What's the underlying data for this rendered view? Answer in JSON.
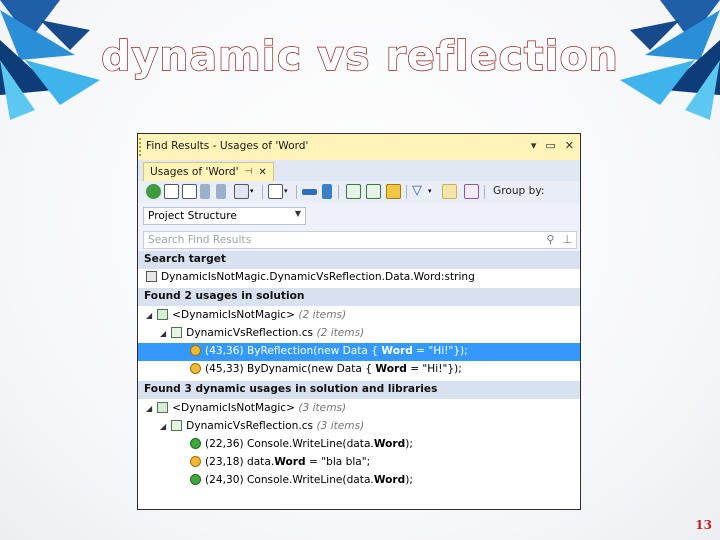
{
  "slide": {
    "title": "dynamic vs reflection",
    "page_number": "13"
  },
  "window": {
    "title": "Find Results - Usages of 'Word'",
    "tab_label": "Usages of 'Word'",
    "group_by_label": "Group by:",
    "structure_select": "Project Structure",
    "search_placeholder": "Search Find Results"
  },
  "results": {
    "search_target_header": "Search target",
    "search_target_value": "DynamicIsNotMagic.DynamicVsReflection.Data.Word:string",
    "section1_header": "Found 2 usages in solution",
    "s1_project": "<DynamicIsNotMagic>",
    "s1_project_count": "(2 items)",
    "s1_file": "DynamicVsReflection.cs",
    "s1_file_count": "(2 items)",
    "s1_item1_loc": "(43,36)",
    "s1_item1_pre": "ByReflection(new Data {",
    "s1_item1_bold": "Word",
    "s1_item1_post": "= \"Hi!\"});",
    "s1_item2_loc": "(45,33)",
    "s1_item2_pre": "ByDynamic(new Data {",
    "s1_item2_bold": "Word",
    "s1_item2_post": "= \"Hi!\"});",
    "section2_header": "Found 3 dynamic usages in solution and libraries",
    "s2_project": "<DynamicIsNotMagic>",
    "s2_project_count": "(3 items)",
    "s2_file": "DynamicVsReflection.cs",
    "s2_file_count": "(3 items)",
    "s2_item1_loc": "(22,36)",
    "s2_item1_pre": "Console.WriteLine(data.",
    "s2_item1_bold": "Word",
    "s2_item1_post": ");",
    "s2_item2_loc": "(23,18)",
    "s2_item2_pre": "data.",
    "s2_item2_bold": "Word",
    "s2_item2_post": "= \"bla bla\";",
    "s2_item3_loc": "(24,30)",
    "s2_item3_pre": "Console.WriteLine(data.",
    "s2_item3_bold": "Word",
    "s2_item3_post": ");"
  },
  "colors": {
    "title_bar": "#fff3b8",
    "selection": "#3399ff",
    "section_header": "#d8e1ef",
    "title_outline": "#8b1e1e"
  }
}
